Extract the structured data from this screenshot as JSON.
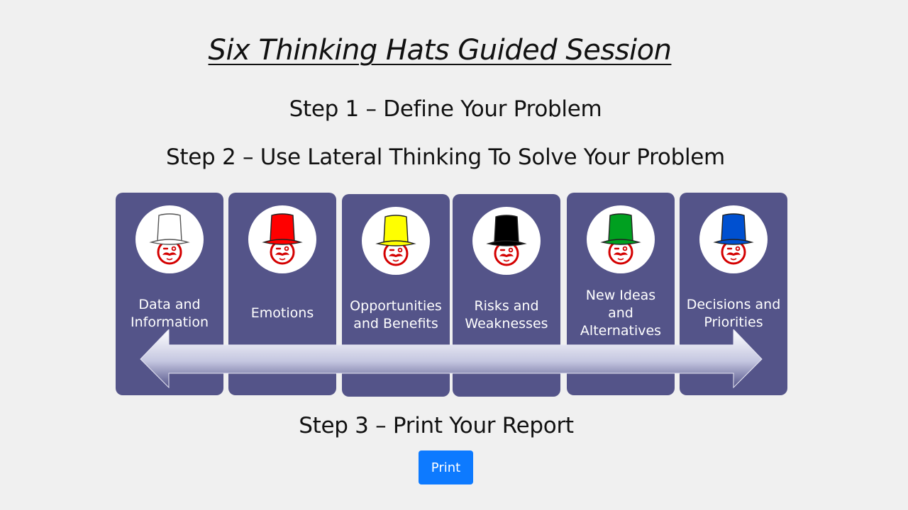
{
  "title": "Six Thinking Hats Guided Session",
  "steps": {
    "step1": "Step 1 – Define Your Problem",
    "step2": "Step 2 – Use Lateral Thinking To Solve Your Problem",
    "step3": "Step 3 – Print Your Report"
  },
  "hats": [
    {
      "label": "Data and\nInformation",
      "hat_color": "#ffffff",
      "icon": "white-hat-icon"
    },
    {
      "label": "Emotions",
      "hat_color": "#ff0000",
      "icon": "red-hat-icon"
    },
    {
      "label": "Opportunities\nand Benefits",
      "hat_color": "#ffff00",
      "icon": "yellow-hat-icon"
    },
    {
      "label": "Risks and\nWeaknesses",
      "hat_color": "#000000",
      "icon": "black-hat-icon"
    },
    {
      "label": "New Ideas\nand\nAlternatives",
      "hat_color": "#00a020",
      "icon": "green-hat-icon"
    },
    {
      "label": "Decisions and\nPriorities",
      "hat_color": "#0050d0",
      "icon": "blue-hat-icon"
    }
  ],
  "print_button": {
    "label": "Print",
    "color": "#0d7aff"
  },
  "card_color": "#545489",
  "face_color": "#d40000"
}
